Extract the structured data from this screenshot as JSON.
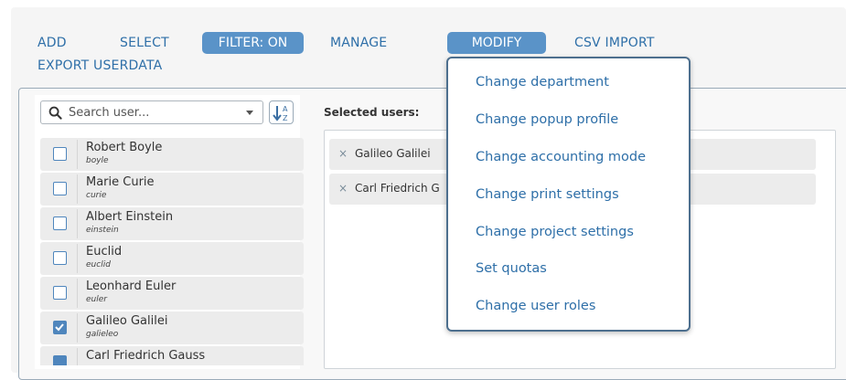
{
  "toolbar": {
    "add": "ADD",
    "select": "SELECT",
    "filter": "FILTER: ON",
    "manage": "MANAGE",
    "modify": "MODIFY",
    "csv_import": "CSV IMPORT",
    "export_userdata": "EXPORT USERDATA"
  },
  "search": {
    "placeholder": "Search user..."
  },
  "users": [
    {
      "name": "Robert Boyle",
      "login": "boyle",
      "checked": false
    },
    {
      "name": "Marie Curie",
      "login": "curie",
      "checked": false
    },
    {
      "name": "Albert Einstein",
      "login": "einstein",
      "checked": false
    },
    {
      "name": "Euclid",
      "login": "euclid",
      "checked": false
    },
    {
      "name": "Leonhard Euler",
      "login": "euler",
      "checked": false
    },
    {
      "name": "Galileo Galilei",
      "login": "galieleo",
      "checked": true
    },
    {
      "name": "Carl Friedrich Gauss",
      "login": "",
      "checked": true
    }
  ],
  "selected": {
    "title": "Selected users:",
    "chips": [
      "Galileo Galilei",
      "Carl Friedrich G"
    ]
  },
  "modify_menu": [
    "Change department",
    "Change popup profile",
    "Change accounting mode",
    "Change print settings",
    "Change project settings",
    "Set quotas",
    "Change user roles"
  ],
  "colors": {
    "accent": "#2e6fa8",
    "active_pill": "#5a93c8",
    "checkbox": "#4f86bd"
  }
}
